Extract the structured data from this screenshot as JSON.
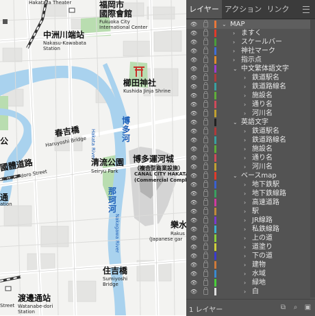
{
  "map": {
    "places": {
      "theater": {
        "en": "Hakataza Theater"
      },
      "fukuoka_city": {
        "jp": "福岡市",
        "jp2": "國際會館",
        "en": "Fukuoka City",
        "en2": "International Center"
      },
      "nakasu": {
        "jp": "中洲川端站",
        "en": "Nakasu-Kawabata",
        "en2": "Station"
      },
      "kushida": {
        "jp": "櫛田神社",
        "en": "Kushida Jinja Shrine"
      },
      "hakata_river": {
        "jp": "博多河",
        "en": "Hakata River"
      },
      "haruyoshi": {
        "jp": "春吉橋",
        "en": "Haruyoshi Bridge"
      },
      "kokutai": {
        "jp": "國體道路",
        "en": "Kokutai doro Street"
      },
      "seiryu": {
        "jp": "清流公園",
        "en": "Seiryu Park"
      },
      "canal": {
        "jp": "博多運河城",
        "jp2": "（複合型商業設施）",
        "en": "CANAL CITY HAKATA",
        "en2": "(Commercial Complex)"
      },
      "naka_river": {
        "jp": "那珂河",
        "en": "Nakagawa River"
      },
      "rakusui": {
        "jp": "樂水",
        "en": "Rakus",
        "en2": "(Japanese gar"
      },
      "sumiyoshi": {
        "jp": "住吉橋",
        "en": "Sumiyoshi",
        "en2": "Bridge"
      },
      "watanabe": {
        "jp": "渡邊通站",
        "en": "Watanabe-dori",
        "en2": "Station"
      },
      "left_jp1": {
        "jp": "公"
      },
      "left_en1": {
        "en": "ation"
      },
      "left_jp2": {
        "jp": "通"
      },
      "left_en2": {
        "en": "Street"
      }
    }
  },
  "panel": {
    "tabs": [
      "レイヤー",
      "アクション",
      "リンク"
    ],
    "menu_icon": "hamburger-menu-icon",
    "layers": [
      {
        "name": "MAP",
        "depth": 0,
        "open": true,
        "color": "#e8773a"
      },
      {
        "name": "ますく",
        "depth": 1,
        "open": false,
        "color": "#e23a2a"
      },
      {
        "name": "スケールバー",
        "depth": 1,
        "open": false,
        "color": "#4a9e3a"
      },
      {
        "name": "神社マーク",
        "depth": 1,
        "open": false,
        "color": "#3f6fd8"
      },
      {
        "name": "指示点",
        "depth": 1,
        "open": false,
        "color": "#e08b2a"
      },
      {
        "name": "中文繁体語文字",
        "depth": 1,
        "open": true,
        "color": "#9e3ad0"
      },
      {
        "name": "鉄道駅名",
        "depth": 2,
        "open": false,
        "color": "#b03a3a"
      },
      {
        "name": "鉄道路線名",
        "depth": 2,
        "open": false,
        "color": "#3aa0a0"
      },
      {
        "name": "施設名",
        "depth": 2,
        "open": false,
        "color": "#5fae3a"
      },
      {
        "name": "通り名",
        "depth": 2,
        "open": false,
        "color": "#d04a5a"
      },
      {
        "name": "河川名",
        "depth": 2,
        "open": false,
        "color": "#c0a030"
      },
      {
        "name": "英語文字",
        "depth": 1,
        "open": true,
        "color": "#222222"
      },
      {
        "name": "鉄道駅名",
        "depth": 2,
        "open": false,
        "color": "#b03a3a"
      },
      {
        "name": "鉄道路線名",
        "depth": 2,
        "open": false,
        "color": "#3aa0a0"
      },
      {
        "name": "施設名",
        "depth": 2,
        "open": false,
        "color": "#5fae3a"
      },
      {
        "name": "通り名",
        "depth": 2,
        "open": false,
        "color": "#d04a5a"
      },
      {
        "name": "河川名",
        "depth": 2,
        "open": false,
        "color": "#c0a030"
      },
      {
        "name": "ベースmap",
        "depth": 1,
        "open": true,
        "color": "#e23a2a"
      },
      {
        "name": "地下鉄駅",
        "depth": 2,
        "open": false,
        "color": "#3a60d0"
      },
      {
        "name": "地下鉄線路",
        "depth": 2,
        "open": false,
        "color": "#3aa060"
      },
      {
        "name": "高速道路",
        "depth": 2,
        "open": false,
        "color": "#d03aa0"
      },
      {
        "name": "駅",
        "depth": 2,
        "open": false,
        "color": "#c08a3a"
      },
      {
        "name": "JR線路",
        "depth": 2,
        "open": false,
        "color": "#7a3ad0"
      },
      {
        "name": "私鉄線路",
        "depth": 2,
        "open": false,
        "color": "#3ab0d0"
      },
      {
        "name": "上の道",
        "depth": 2,
        "open": false,
        "color": "#8ad03a"
      },
      {
        "name": "道塗り",
        "depth": 2,
        "open": false,
        "color": "#d0d03a"
      },
      {
        "name": "下の道",
        "depth": 2,
        "open": false,
        "color": "#3a3ad0"
      },
      {
        "name": "建物",
        "depth": 2,
        "open": false,
        "color": "#d07a3a"
      },
      {
        "name": "水域",
        "depth": 2,
        "open": false,
        "color": "#3a8ad0"
      },
      {
        "name": "緑地",
        "depth": 2,
        "open": false,
        "color": "#4ad03a"
      },
      {
        "name": "白",
        "depth": 2,
        "open": false,
        "color": "#e0e0e0"
      }
    ],
    "footer": {
      "count": "1 レイヤー"
    }
  }
}
